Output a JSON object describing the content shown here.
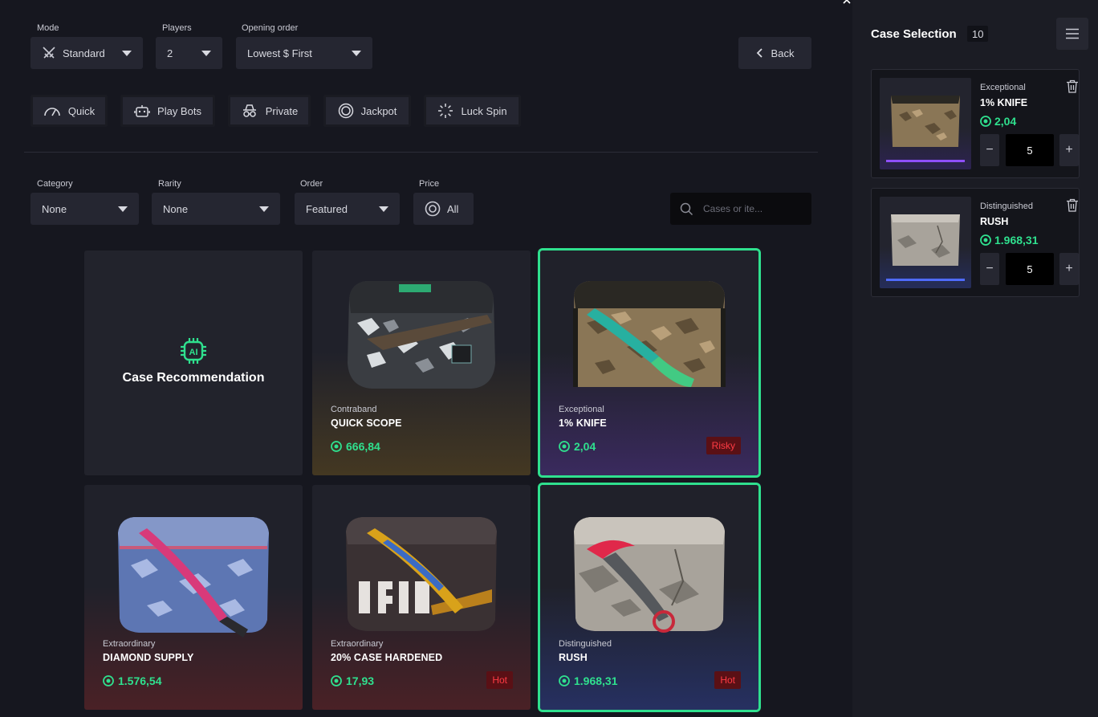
{
  "filters_top": {
    "mode": {
      "label": "Mode",
      "value": "Standard"
    },
    "players": {
      "label": "Players",
      "value": "2"
    },
    "opening_order": {
      "label": "Opening order",
      "value": "Lowest $ First"
    },
    "back_label": "Back"
  },
  "game_types": [
    {
      "label": "Quick",
      "icon": "speedometer-icon"
    },
    {
      "label": "Play Bots",
      "icon": "robot-icon"
    },
    {
      "label": "Private",
      "icon": "incognito-icon"
    },
    {
      "label": "Jackpot",
      "icon": "jackpot-icon"
    },
    {
      "label": "Luck Spin",
      "icon": "spinner-icon"
    }
  ],
  "filters": {
    "category": {
      "label": "Category",
      "value": "None"
    },
    "rarity": {
      "label": "Rarity",
      "value": "None"
    },
    "order": {
      "label": "Order",
      "value": "Featured"
    },
    "price": {
      "label": "Price",
      "value": "All"
    },
    "search_placeholder": "Cases or ite..."
  },
  "recommendation": {
    "icon_text": "AI",
    "title": "Case Recommendation"
  },
  "cases": [
    {
      "rarity": "Contraband",
      "name": "QUICK SCOPE",
      "price": "666,84",
      "badge": "",
      "selected": false
    },
    {
      "rarity": "Exceptional",
      "name": "1% KNIFE",
      "price": "2,04",
      "badge": "Risky",
      "selected": true
    },
    {
      "rarity": "Extraordinary",
      "name": "DIAMOND SUPPLY",
      "price": "1.576,54",
      "badge": "",
      "selected": false
    },
    {
      "rarity": "Extraordinary",
      "name": "20% CASE HARDENED",
      "price": "17,93",
      "badge": "Hot",
      "selected": false
    },
    {
      "rarity": "Distinguished",
      "name": "RUSH",
      "price": "1.968,31",
      "badge": "Hot",
      "selected": true
    }
  ],
  "sidebar": {
    "title": "Case Selection",
    "count": "10",
    "items": [
      {
        "rarity": "Exceptional",
        "name": "1% KNIFE",
        "price": "2,04",
        "quantity": "5"
      },
      {
        "rarity": "Distinguished",
        "name": "RUSH",
        "price": "1.968,31",
        "quantity": "5"
      }
    ]
  },
  "colors": {
    "accent": "#2fe08e",
    "badge_bg": "#5a1015",
    "badge_text": "#ff3b44",
    "background": "#16171f"
  }
}
